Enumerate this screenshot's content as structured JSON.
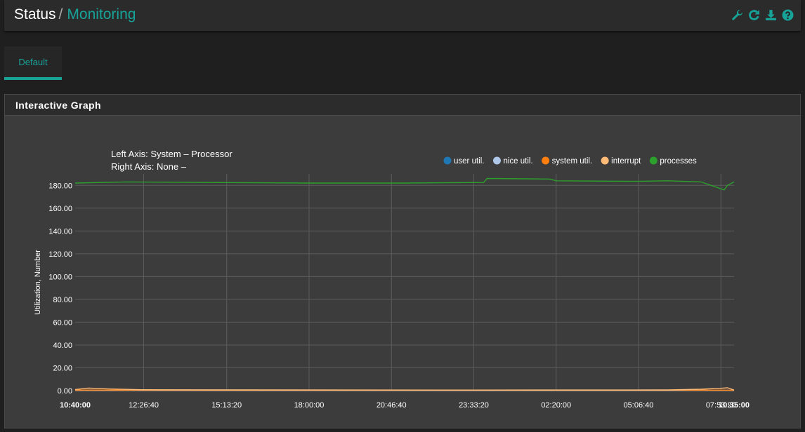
{
  "breadcrumb": {
    "root": "Status",
    "separator": "/",
    "current": "Monitoring"
  },
  "toolbar": {
    "icons": [
      "wrench-icon",
      "refresh-icon",
      "download-icon",
      "help-icon"
    ],
    "accent": "#17a398"
  },
  "tabs": [
    {
      "label": "Default",
      "active": true
    }
  ],
  "panel": {
    "title": "Interactive Graph"
  },
  "graph": {
    "left_axis_label": "Left Axis: System – Processor",
    "right_axis_label": "Right Axis: None –"
  },
  "chart_data": {
    "type": "line",
    "ylabel": "Utilization, Number",
    "ylim": [
      0,
      190
    ],
    "y_ticks": [
      "0.00",
      "20.00",
      "40.00",
      "60.00",
      "80.00",
      "100.00",
      "120.00",
      "140.00",
      "160.00",
      "180.00"
    ],
    "x_ticks": [
      {
        "label": "10:40:00",
        "bold": true
      },
      {
        "label": "12:26:40",
        "bold": false
      },
      {
        "label": "15:13:20",
        "bold": false
      },
      {
        "label": "18:00:00",
        "bold": false
      },
      {
        "label": "20:46:40",
        "bold": false
      },
      {
        "label": "23:33:20",
        "bold": false
      },
      {
        "label": "02:20:00",
        "bold": false
      },
      {
        "label": "05:06:40",
        "bold": false
      },
      {
        "label": "07:53:20",
        "bold": false
      },
      {
        "label": "10:35:00",
        "bold": true
      }
    ],
    "x_tick_fraction": [
      0,
      0.104,
      0.23,
      0.355,
      0.48,
      0.605,
      0.73,
      0.855,
      0.98,
      1.0
    ],
    "legend": [
      {
        "name": "user util.",
        "color": "#1f77b4"
      },
      {
        "name": "nice util.",
        "color": "#aec7e8"
      },
      {
        "name": "system util.",
        "color": "#ff7f0e"
      },
      {
        "name": "interrupt",
        "color": "#ffbb78"
      },
      {
        "name": "processes",
        "color": "#2ca02c"
      }
    ],
    "series": [
      {
        "name": "processes",
        "color": "#2ca02c",
        "x_fraction": [
          0,
          0.08,
          0.2,
          0.35,
          0.5,
          0.62,
          0.625,
          0.72,
          0.73,
          0.85,
          0.9,
          0.95,
          0.985,
          0.99,
          1.0
        ],
        "values": [
          182,
          183,
          182.5,
          182,
          182,
          182.5,
          186,
          185.5,
          184,
          183.5,
          184,
          183,
          176,
          180,
          183
        ]
      },
      {
        "name": "interrupt",
        "color": "#ffbb78",
        "x_fraction": [
          0,
          0.02,
          0.05,
          0.1,
          0.3,
          0.6,
          0.9,
          0.95,
          0.98,
          0.99,
          1.0
        ],
        "values": [
          1,
          2.2,
          1.5,
          0.8,
          0.6,
          0.5,
          0.6,
          1.2,
          2,
          2.5,
          0.5
        ]
      },
      {
        "name": "system util.",
        "color": "#ff7f0e",
        "x_fraction": [
          0,
          0.1,
          0.5,
          0.9,
          1.0
        ],
        "values": [
          0.5,
          0.5,
          0.4,
          0.5,
          0.4
        ]
      }
    ]
  }
}
